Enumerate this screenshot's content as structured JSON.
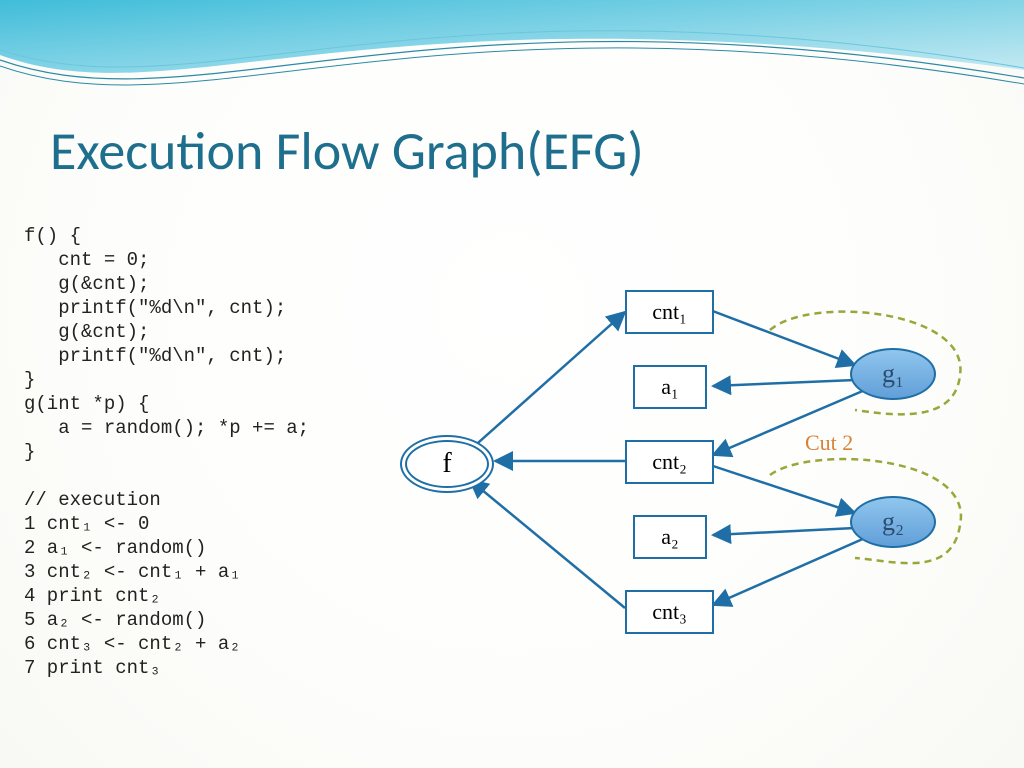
{
  "slide": {
    "title": "Execution Flow Graph(EFG)"
  },
  "code": {
    "line1": "f() {",
    "line2": "   cnt = 0;",
    "line3": "   g(&cnt);",
    "line4": "   printf(\"%d\\n\", cnt);",
    "line5": "   g(&cnt);",
    "line6": "   printf(\"%d\\n\", cnt);",
    "line7": "}",
    "line8": "g(int *p) {",
    "line9": "   a = random(); *p += a;",
    "line10": "}",
    "exec_header": "// execution",
    "exec1": "1 cnt₁ <- 0",
    "exec2": "2 a₁ <- random()",
    "exec3": "3 cnt₂ <- cnt₁ + a₁",
    "exec4": "4 print cnt₂",
    "exec5": "5 a₂ <- random()",
    "exec6": "6 cnt₃ <- cnt₂ + a₂",
    "exec7": "7 print cnt₃"
  },
  "diagram": {
    "nodes": {
      "f": "f",
      "cnt1": "cnt₁",
      "a1": "a₁",
      "cnt2": "cnt₂",
      "a2": "a₂",
      "cnt3": "cnt₃",
      "g1": "g₁",
      "g2": "g₂"
    },
    "annotation": "Cut 2",
    "edges_desc": "f→cnt1, cnt1→g1, g1→a1, a1→cnt2, cnt2→f, cnt2→g2, g2→a2, a2→cnt3, cnt3→f",
    "cuts_desc": "dashed arcs around g1 and g2"
  }
}
